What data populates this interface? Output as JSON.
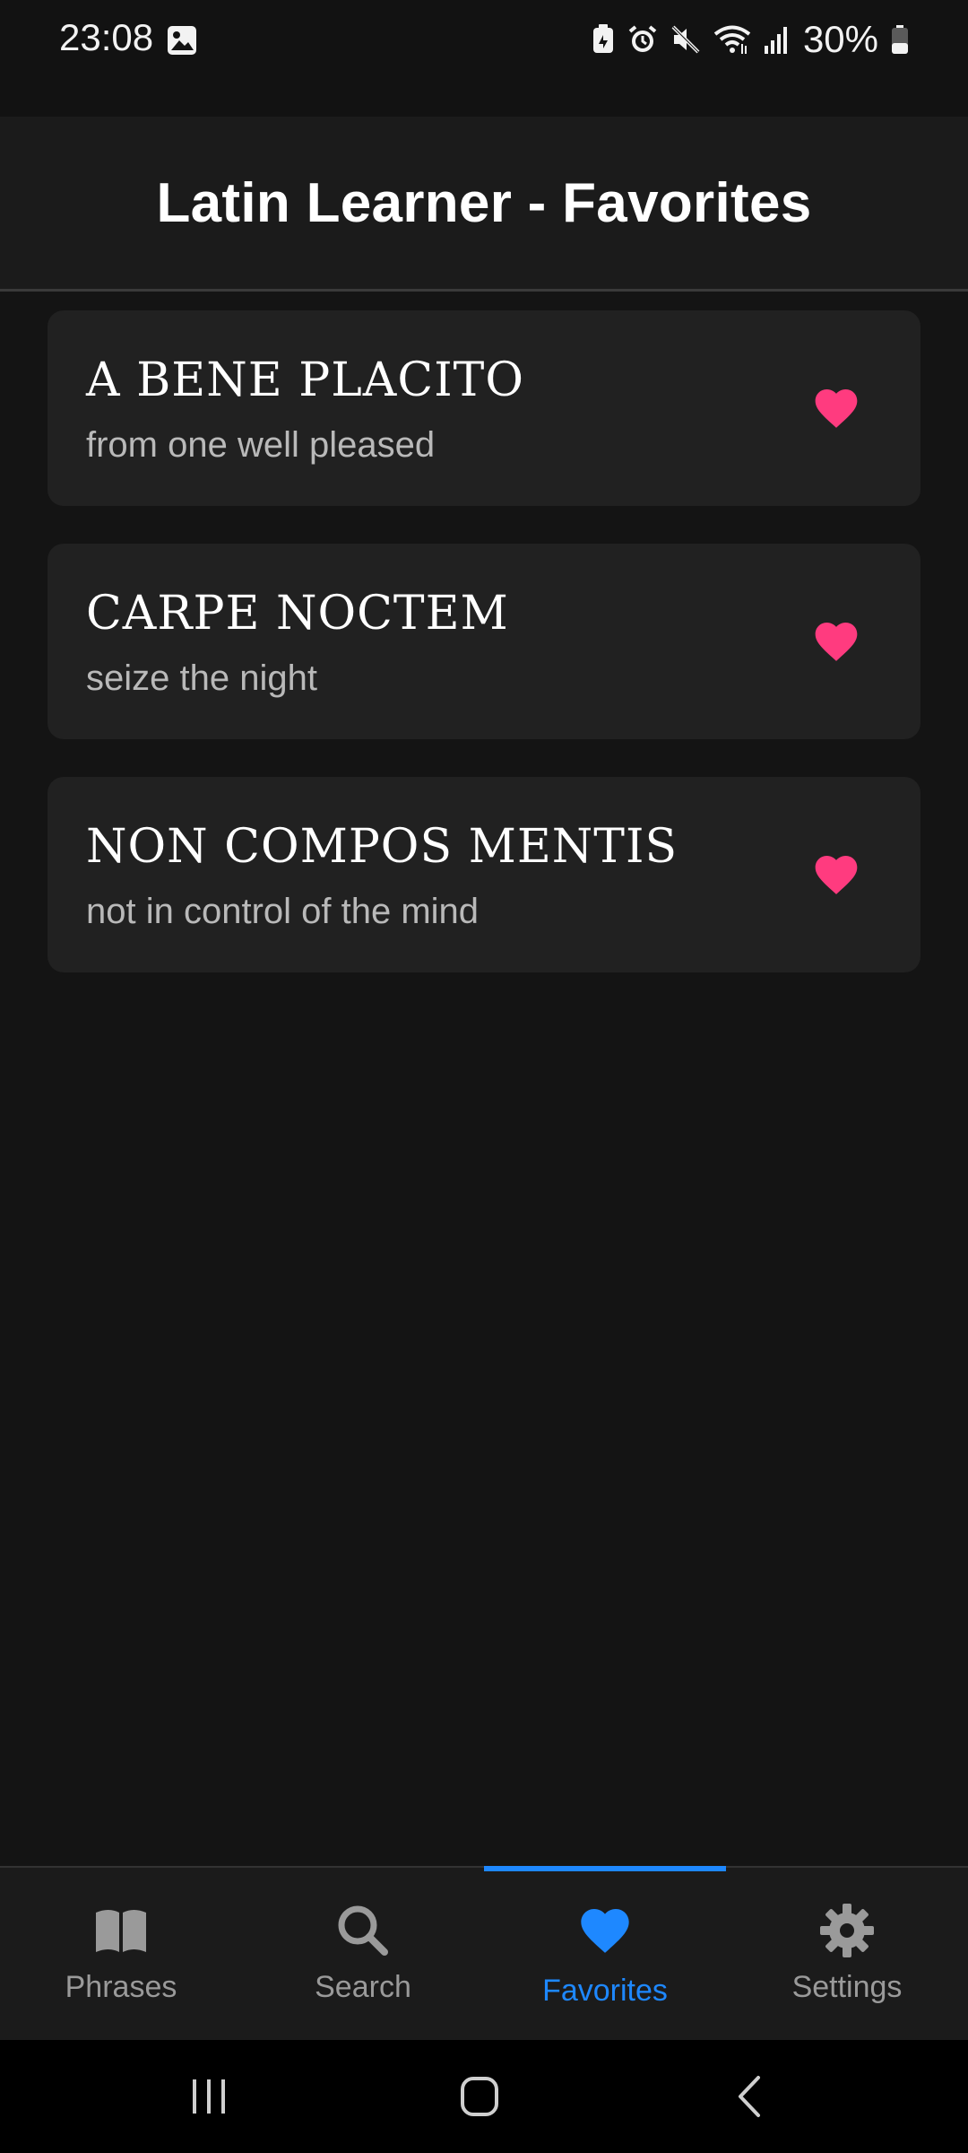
{
  "status_bar": {
    "time": "23:08",
    "battery": "30%",
    "icons": [
      "gallery-icon",
      "battery-saver-icon",
      "alarm-icon",
      "mute-icon",
      "wifi-icon",
      "signal-icon",
      "battery-icon"
    ]
  },
  "header": {
    "title": "Latin Learner - Favorites"
  },
  "favorites": [
    {
      "phrase": "A BENE PLACITO",
      "translation": "from one well pleased",
      "icon": "heart-icon"
    },
    {
      "phrase": "CARPE NOCTEM",
      "translation": "seize the night",
      "icon": "heart-icon"
    },
    {
      "phrase": "NON COMPOS MENTIS",
      "translation": "not in control of the mind",
      "icon": "heart-icon"
    }
  ],
  "bottom_nav": {
    "items": [
      {
        "label": "Phrases",
        "icon": "book-icon"
      },
      {
        "label": "Search",
        "icon": "search-icon"
      },
      {
        "label": "Favorites",
        "icon": "heart-icon"
      },
      {
        "label": "Settings",
        "icon": "gear-icon"
      }
    ],
    "active": "Favorites"
  },
  "system_nav": {
    "buttons": [
      "recents-button",
      "home-button",
      "back-button"
    ]
  },
  "colors": {
    "accent": "#1e88ff",
    "heart": "#ff3b7f",
    "background": "#141414",
    "card": "#212121"
  }
}
